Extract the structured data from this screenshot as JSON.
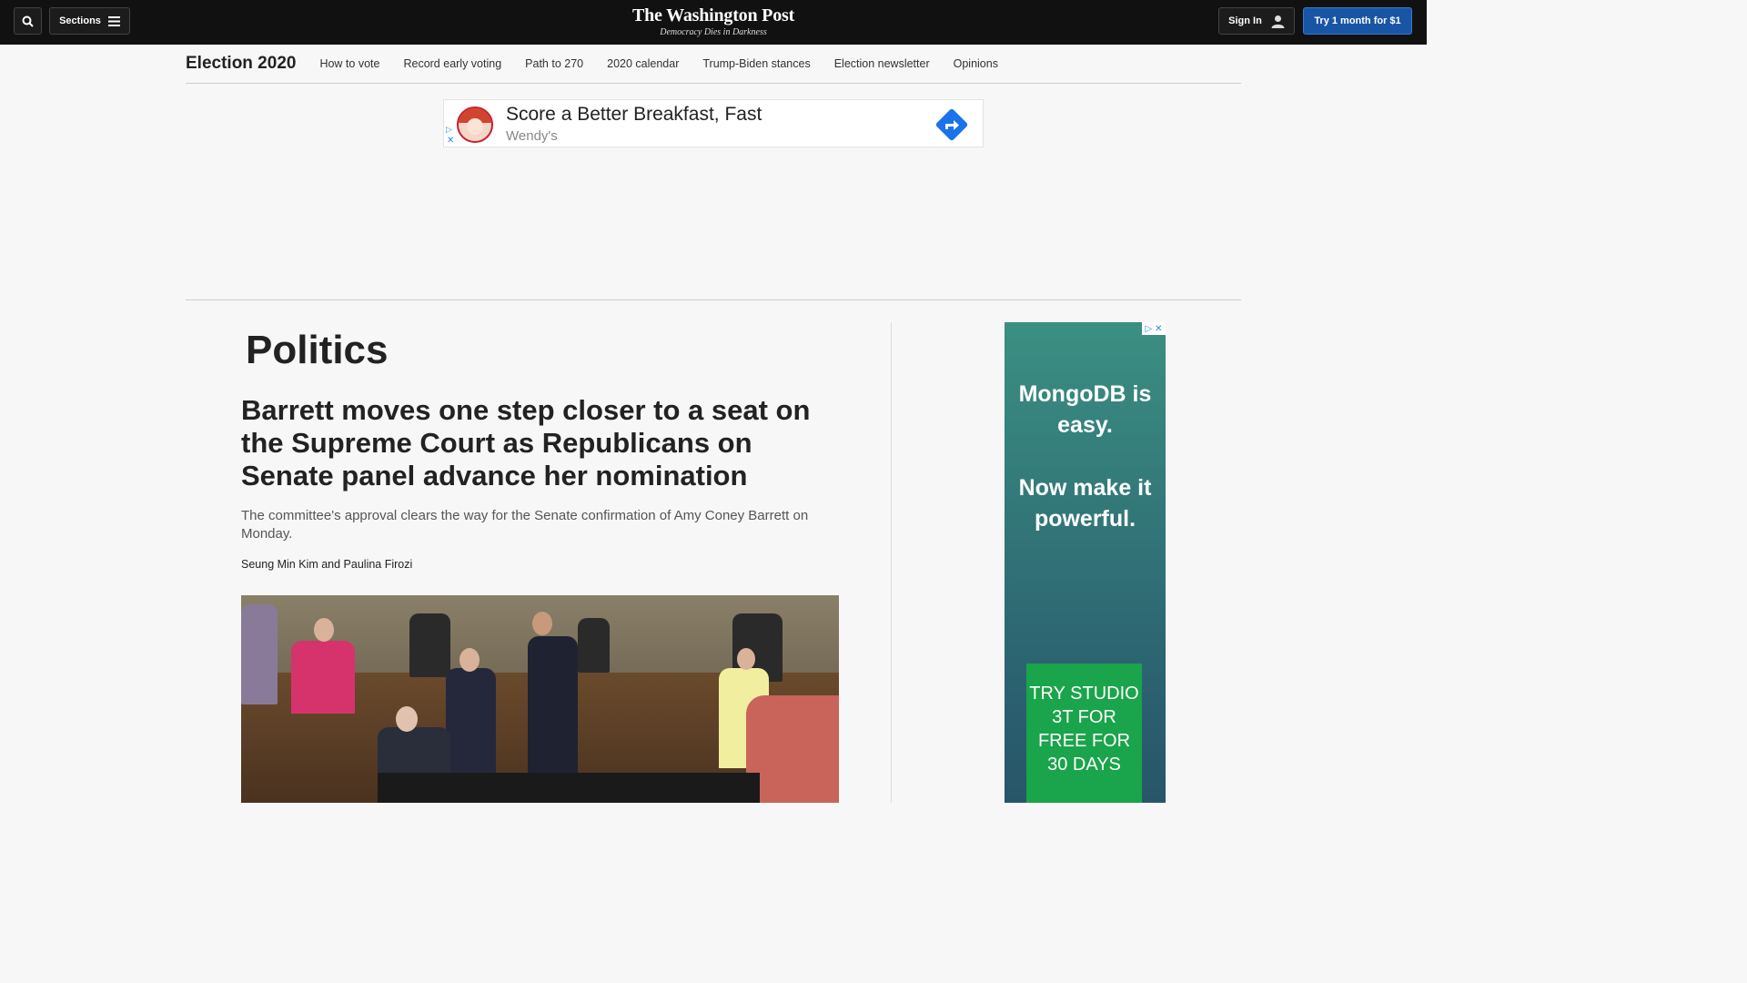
{
  "header": {
    "sections_label": "Sections",
    "logo_title": "The Washington Post",
    "logo_tagline": "Democracy Dies in Darkness",
    "signin_label": "Sign In",
    "subscribe_label": "Try 1 month for $1"
  },
  "election_nav": {
    "title": "Election 2020",
    "links": [
      "How to vote",
      "Record early voting",
      "Path to 270",
      "2020 calendar",
      "Trump-Biden stances",
      "Election newsletter",
      "Opinions"
    ]
  },
  "top_ad": {
    "headline": "Score a Better Breakfast, Fast",
    "brand": "Wendy's"
  },
  "article": {
    "section": "Politics",
    "headline": "Barrett moves one step closer to a seat on the Supreme Court as Republicans on Senate panel advance her nomination",
    "dek": "The committee's approval clears the way for the Senate confirmation of Amy Coney Barrett on Monday.",
    "byline": "Seung Min Kim and Paulina Firozi"
  },
  "side_ad": {
    "line1": "MongoDB is easy.",
    "line2": "Now make it powerful.",
    "cta": "TRY STUDIO 3T FOR FREE FOR 30 DAYS"
  },
  "colors": {
    "topbar": "#111111",
    "subscribe_button": "#1955a5",
    "side_ad_cta": "#1aa44b"
  }
}
